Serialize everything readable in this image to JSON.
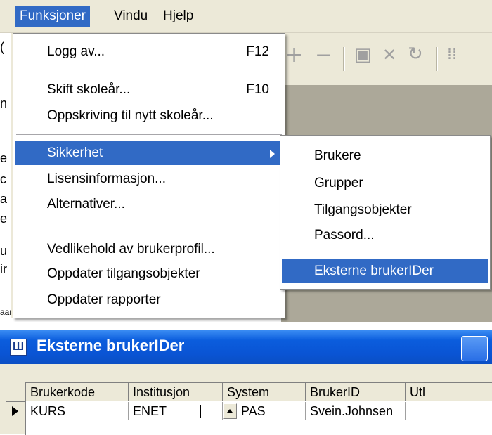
{
  "menubar": {
    "items": [
      {
        "label": "Funksjoner"
      },
      {
        "label": "Vindu"
      },
      {
        "label": "Hjelp"
      }
    ]
  },
  "menu": {
    "items": [
      {
        "label": "Logg av...",
        "shortcut": "F12"
      },
      {
        "label": "Skift skoleår...",
        "shortcut": "F10"
      },
      {
        "label": "Oppskriving til nytt skoleår..."
      },
      {
        "label": "Sikkerhet"
      },
      {
        "label": "Lisensinformasjon..."
      },
      {
        "label": "Alternativer..."
      },
      {
        "label": "Vedlikehold av brukerprofil..."
      },
      {
        "label": "Oppdater tilgangsobjekter"
      },
      {
        "label": "Oppdater rapporter"
      }
    ]
  },
  "submenu": {
    "items": [
      {
        "label": "Brukere"
      },
      {
        "label": "Grupper"
      },
      {
        "label": "Tilgangsobjekter"
      },
      {
        "label": "Passord..."
      },
      {
        "label": "Eksterne brukerIDer"
      }
    ]
  },
  "toolbar": {
    "icons": [
      "plus-icon",
      "minus-icon",
      "save-icon",
      "delete-icon",
      "refresh-icon",
      "grid-icon"
    ],
    "glyphs": [
      "+",
      "−",
      "▣",
      "✕",
      "↻",
      "⁞⁞"
    ]
  },
  "window": {
    "title": "Eksterne brukerIDer",
    "icon_glyph": "Ш"
  },
  "grid": {
    "columns": [
      "Brukerkode",
      "Institusjon",
      "System",
      "BrukerID",
      "Utl"
    ],
    "rows": [
      [
        "KURS",
        "ENET",
        "PAS",
        "Svein.Johnsen",
        ""
      ]
    ]
  },
  "leftstrip": {
    "chars": [
      "(",
      "n",
      "e",
      "c",
      "a",
      "e",
      "u",
      "ir",
      "aan"
    ]
  },
  "colors": {
    "highlight": "#316ac5",
    "menubar_bg": "#ece9d8",
    "titlebar": "#0a54d4"
  }
}
